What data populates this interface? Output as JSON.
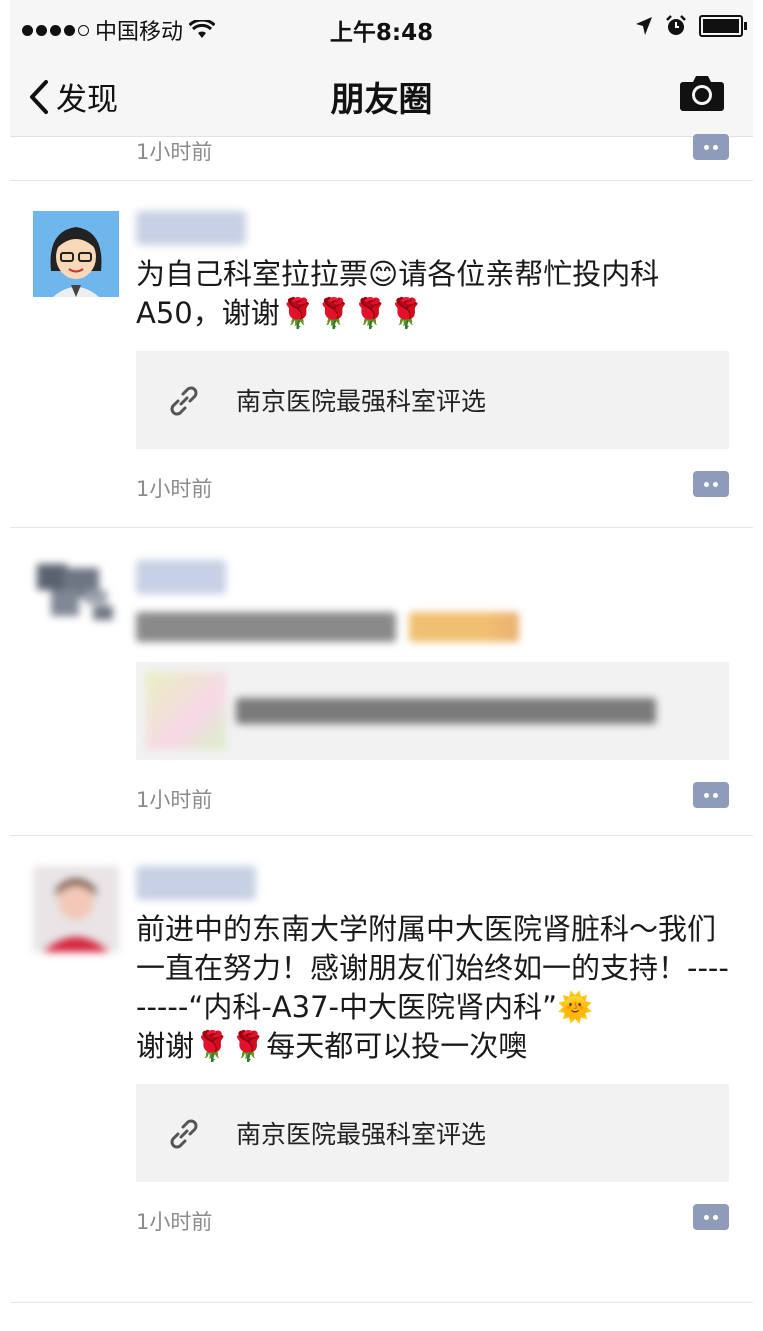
{
  "statusbar": {
    "carrier": "中国移动",
    "time": "上午8:48"
  },
  "nav": {
    "back_label": "发现",
    "title": "朋友圈",
    "camera_icon": "camera-icon"
  },
  "feed": {
    "top_partial": {
      "time": "1小时前"
    },
    "posts": [
      {
        "text": "为自己科室拉拉票😊请各位亲帮忙投内科A50，谢谢🌹🌹🌹🌹",
        "link_title": "南京医院最强科室评选",
        "time": "1小时前"
      },
      {
        "text": "",
        "link_title": "",
        "time": "1小时前"
      },
      {
        "text": "前进中的东南大学附属中大医院肾脏科～我们一直在努力！感谢朋友们始终如一的支持！---------“内科-A37-中大医院肾内科”🌞\n谢谢🌹🌹每天都可以投一次噢",
        "link_title": "南京医院最强科室评选",
        "time": "1小时前"
      }
    ]
  }
}
